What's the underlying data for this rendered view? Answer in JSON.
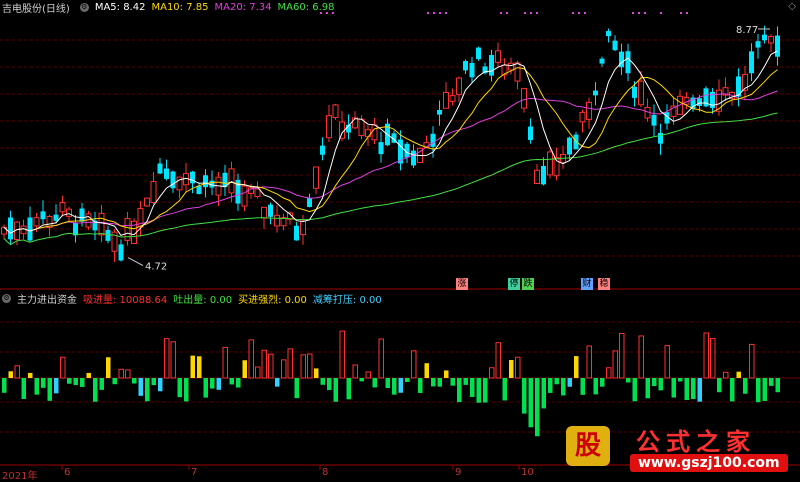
{
  "price_panel": {
    "title": "吉电股份(日线)",
    "ma_labels": [
      {
        "label": "MA5: 8.42",
        "color": "#ffffff"
      },
      {
        "label": "MA10: 7.85",
        "color": "#ffd700"
      },
      {
        "label": "MA20: 7.34",
        "color": "#e040e0"
      },
      {
        "label": "MA60: 6.98",
        "color": "#40e040"
      }
    ],
    "high_label": "8.77",
    "low_label": "4.72",
    "event_tags": [
      {
        "text": "涨",
        "bg": "#ff8080"
      },
      {
        "text": "停",
        "bg": "#40d0a0"
      },
      {
        "text": "跌",
        "bg": "#50d050"
      },
      {
        "text": "财",
        "bg": "#60a0ff"
      },
      {
        "text": "稳",
        "bg": "#ff8080"
      }
    ]
  },
  "indicator_panel": {
    "title": "主力进出资金",
    "items": [
      {
        "label": "吸进量: 10088.64",
        "color": "#ff3030"
      },
      {
        "label": "吐出量: 0.00",
        "color": "#40e040"
      },
      {
        "label": "买进强烈: 0.00",
        "color": "#ffd700"
      },
      {
        "label": "减筹打压: 0.00",
        "color": "#40d0ff"
      }
    ]
  },
  "x_axis": [
    "2021年",
    "6",
    "7",
    "8",
    "9",
    "10"
  ],
  "logo": {
    "glyph": "股",
    "name": "公式之家",
    "url": "www.gszj100.com"
  },
  "corner_icon": "diamond-icon",
  "colors": {
    "up": "#ff3030",
    "down": "#00e5ff",
    "ma5": "#ffffff",
    "ma10": "#ffd700",
    "ma20": "#e040e0",
    "ma60": "#40e040"
  },
  "chart_data": {
    "type": "candlestick",
    "price_range": [
      4.5,
      9.0
    ],
    "last_close": 8.6,
    "ma_last": {
      "MA5": 8.42,
      "MA10": 7.85,
      "MA20": 7.34,
      "MA60": 6.98
    },
    "marked_high": 8.77,
    "marked_low": 4.72
  }
}
